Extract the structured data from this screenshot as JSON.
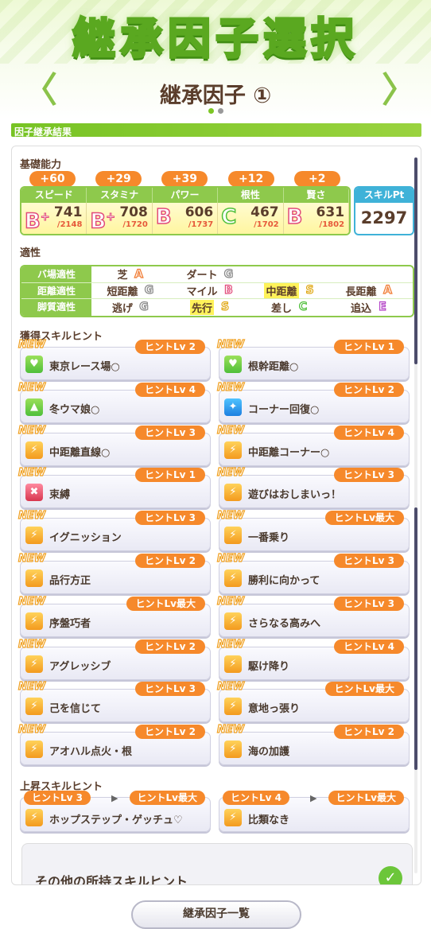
{
  "header": {
    "banner_title": "継承因子選択",
    "subtitle": "継承因子 ①",
    "left_arrow": "〈",
    "right_arrow": "〉"
  },
  "section_bar": "因子継承結果",
  "basic": {
    "label": "基礎能力",
    "stats": [
      {
        "name": "スピード",
        "grade": "B",
        "plus": "+",
        "value": "741",
        "max": "/2148",
        "bonus": "+60"
      },
      {
        "name": "スタミナ",
        "grade": "B",
        "plus": "+",
        "value": "708",
        "max": "/1720",
        "bonus": "+29"
      },
      {
        "name": "パワー",
        "grade": "B",
        "plus": "",
        "value": "606",
        "max": "/1737",
        "bonus": "+39"
      },
      {
        "name": "根性",
        "grade": "C",
        "plus": "",
        "value": "467",
        "max": "/1702",
        "bonus": "+12"
      },
      {
        "name": "賢さ",
        "grade": "B",
        "plus": "",
        "value": "631",
        "max": "/1802",
        "bonus": "+2"
      }
    ],
    "skillpt_label": "スキルPt",
    "skillpt_value": "2297"
  },
  "aptitude": {
    "label": "適性",
    "rows": [
      {
        "label": "バ場適性",
        "items": [
          {
            "name": "芝",
            "grade": "A"
          },
          {
            "name": "ダート",
            "grade": "G"
          }
        ]
      },
      {
        "label": "距離適性",
        "items": [
          {
            "name": "短距離",
            "grade": "G"
          },
          {
            "name": "マイル",
            "grade": "B"
          },
          {
            "name": "中距離",
            "grade": "S"
          },
          {
            "name": "長距離",
            "grade": "A"
          }
        ]
      },
      {
        "label": "脚質適性",
        "items": [
          {
            "name": "逃げ",
            "grade": "G"
          },
          {
            "name": "先行",
            "grade": "S"
          },
          {
            "name": "差し",
            "grade": "C"
          },
          {
            "name": "追込",
            "grade": "E"
          }
        ]
      }
    ]
  },
  "skill_hints": {
    "label": "獲得スキルヒント",
    "new_label": "NEW",
    "items": [
      {
        "name": "東京レース場○",
        "hint": "ヒントLv 2",
        "icon": "green-heart-icon"
      },
      {
        "name": "根幹距離○",
        "hint": "ヒントLv 1",
        "icon": "green-heart-icon"
      },
      {
        "name": "冬ウマ娘○",
        "hint": "ヒントLv 4",
        "icon": "green-buff-icon"
      },
      {
        "name": "コーナー回復○",
        "hint": "ヒントLv 2",
        "icon": "blue-sparkle-icon"
      },
      {
        "name": "中距離直線○",
        "hint": "ヒントLv 3",
        "icon": "speed-icon"
      },
      {
        "name": "中距離コーナー○",
        "hint": "ヒントLv 4",
        "icon": "speed-icon"
      },
      {
        "name": "束縛",
        "hint": "ヒントLv 1",
        "icon": "red-debuff-icon"
      },
      {
        "name": "遊びはおしまいっ！",
        "hint": "ヒントLv 3",
        "icon": "speed-icon"
      },
      {
        "name": "イグニッション",
        "hint": "ヒントLv 3",
        "icon": "speed-icon"
      },
      {
        "name": "一番乗り",
        "hint": "ヒントLv最大",
        "icon": "speed-icon"
      },
      {
        "name": "品行方正",
        "hint": "ヒントLv 2",
        "icon": "speed-icon"
      },
      {
        "name": "勝利に向かって",
        "hint": "ヒントLv 3",
        "icon": "speed-icon"
      },
      {
        "name": "序盤巧者",
        "hint": "ヒントLv最大",
        "icon": "speed-icon"
      },
      {
        "name": "さらなる高みへ",
        "hint": "ヒントLv 3",
        "icon": "speed-icon"
      },
      {
        "name": "アグレッシブ",
        "hint": "ヒントLv 2",
        "icon": "speed-icon"
      },
      {
        "name": "駆け降り",
        "hint": "ヒントLv 4",
        "icon": "speed-icon"
      },
      {
        "name": "己を信じて",
        "hint": "ヒントLv 3",
        "icon": "speed-icon"
      },
      {
        "name": "意地っ張り",
        "hint": "ヒントLv最大",
        "icon": "speed-icon"
      },
      {
        "name": "アオハル点火・根",
        "hint": "ヒントLv 2",
        "icon": "speed-icon"
      },
      {
        "name": "海の加護",
        "hint": "ヒントLv 2",
        "icon": "speed-icon"
      }
    ]
  },
  "upgrade_hints": {
    "label": "上昇スキルヒント",
    "items": [
      {
        "name": "ホップステップ・ゲッチュ♡",
        "from": "ヒントLv 3",
        "to": "ヒントLv最大"
      },
      {
        "name": "比類なき",
        "from": "ヒントLv 4",
        "to": "ヒントLv最大"
      }
    ]
  },
  "other_hints": {
    "label": "その他の所持スキルヒント",
    "toggle": "✓"
  },
  "footer": {
    "list_button": "継承因子一覧"
  }
}
